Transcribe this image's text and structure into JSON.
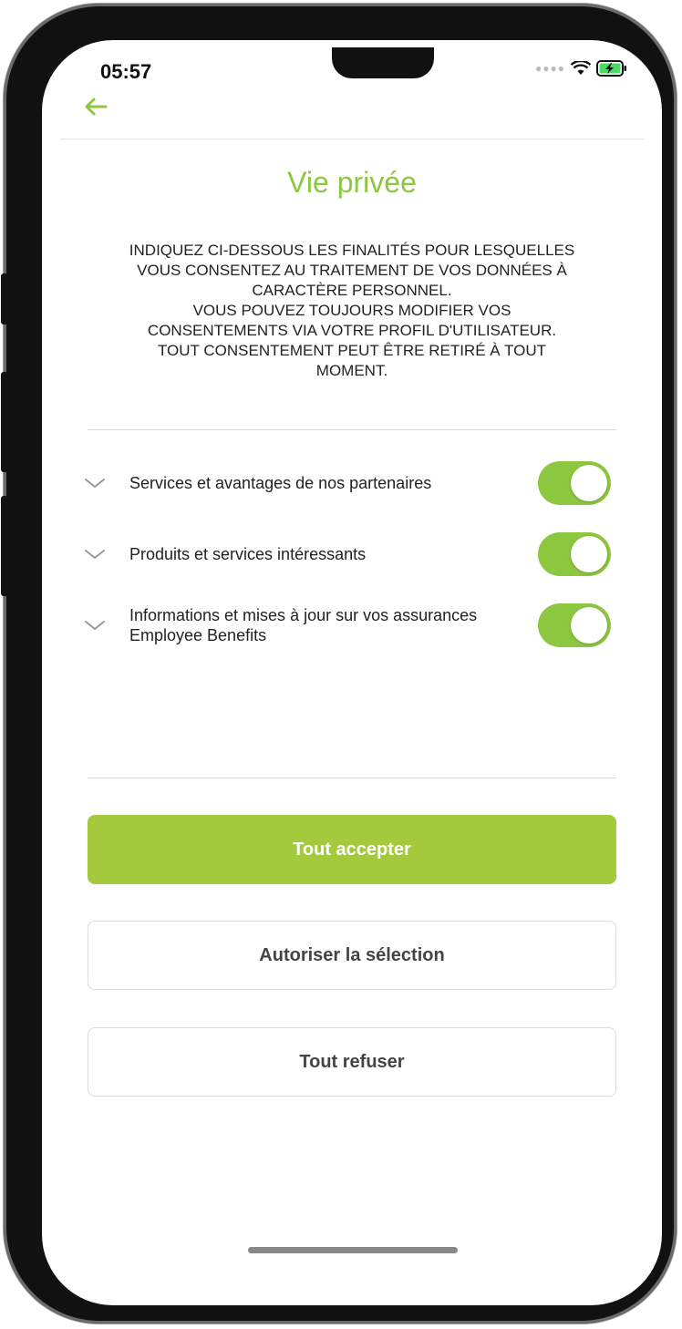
{
  "status_bar": {
    "time": "05:57",
    "signal_icon": "signal-dots-icon",
    "wifi_icon": "wifi-icon",
    "battery_icon": "battery-charging-icon"
  },
  "header": {
    "back_icon": "arrow-left-icon"
  },
  "page": {
    "title": "Vie privée",
    "intro": "INDIQUEZ CI-DESSOUS LES FINALITÉS POUR LESQUELLES\nVOUS CONSENTEZ AU TRAITEMENT DE VOS DONNÉES À\nCARACTÈRE PERSONNEL.\nVOUS POUVEZ TOUJOURS MODIFIER VOS\nCONSENTEMENTS VIA VOTRE PROFIL D'UTILISATEUR.\nTOUT CONSENTEMENT PEUT ÊTRE RETIRÉ À TOUT\nMOMENT."
  },
  "consents": [
    {
      "label": "Services et avantages de nos partenaires",
      "enabled": true
    },
    {
      "label": "Produits et services intéressants",
      "enabled": true
    },
    {
      "label": "Informations et mises à jour sur vos assurances Employee Benefits",
      "enabled": true
    }
  ],
  "actions": {
    "accept_all": "Tout accepter",
    "allow_selection": "Autoriser la sélection",
    "refuse_all": "Tout refuser"
  },
  "colors": {
    "accent": "#8dc63f",
    "primary_button": "#a3c93c",
    "text": "#222222"
  }
}
